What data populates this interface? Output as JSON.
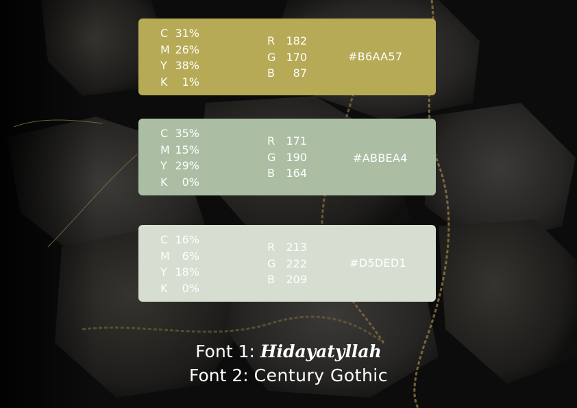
{
  "swatches": [
    {
      "color": "#B6AA57",
      "cmyk": [
        [
          "C",
          "31%"
        ],
        [
          "M",
          "26%"
        ],
        [
          "Y",
          "38%"
        ],
        [
          "K",
          "1%"
        ]
      ],
      "rgb": [
        [
          "R",
          "182"
        ],
        [
          "G",
          "170"
        ],
        [
          "B",
          "87"
        ]
      ],
      "hex": "#B6AA57"
    },
    {
      "color": "#ABBEA4",
      "cmyk": [
        [
          "C",
          "35%"
        ],
        [
          "M",
          "15%"
        ],
        [
          "Y",
          "29%"
        ],
        [
          "K",
          "0%"
        ]
      ],
      "rgb": [
        [
          "R",
          "171"
        ],
        [
          "G",
          "190"
        ],
        [
          "B",
          "164"
        ]
      ],
      "hex": "#ABBEA4"
    },
    {
      "color": "#D5DED1",
      "cmyk": [
        [
          "C",
          "16%"
        ],
        [
          "M",
          "6%"
        ],
        [
          "Y",
          "18%"
        ],
        [
          "K",
          "0%"
        ]
      ],
      "rgb": [
        [
          "R",
          "213"
        ],
        [
          "G",
          "222"
        ],
        [
          "B",
          "209"
        ]
      ],
      "hex": "#D5DED1"
    }
  ],
  "fonts": {
    "font1_label": "Font 1: ",
    "font1_name": "Hidayatyllah",
    "font2_label": "Font 2: ",
    "font2_name": "Century Gothic"
  },
  "background": {
    "image": "dark volcanic rocks with gold chain",
    "base_color": "#0b0b0b",
    "rock_color": "#2f2e2b",
    "chain_color": "#8a7440"
  }
}
